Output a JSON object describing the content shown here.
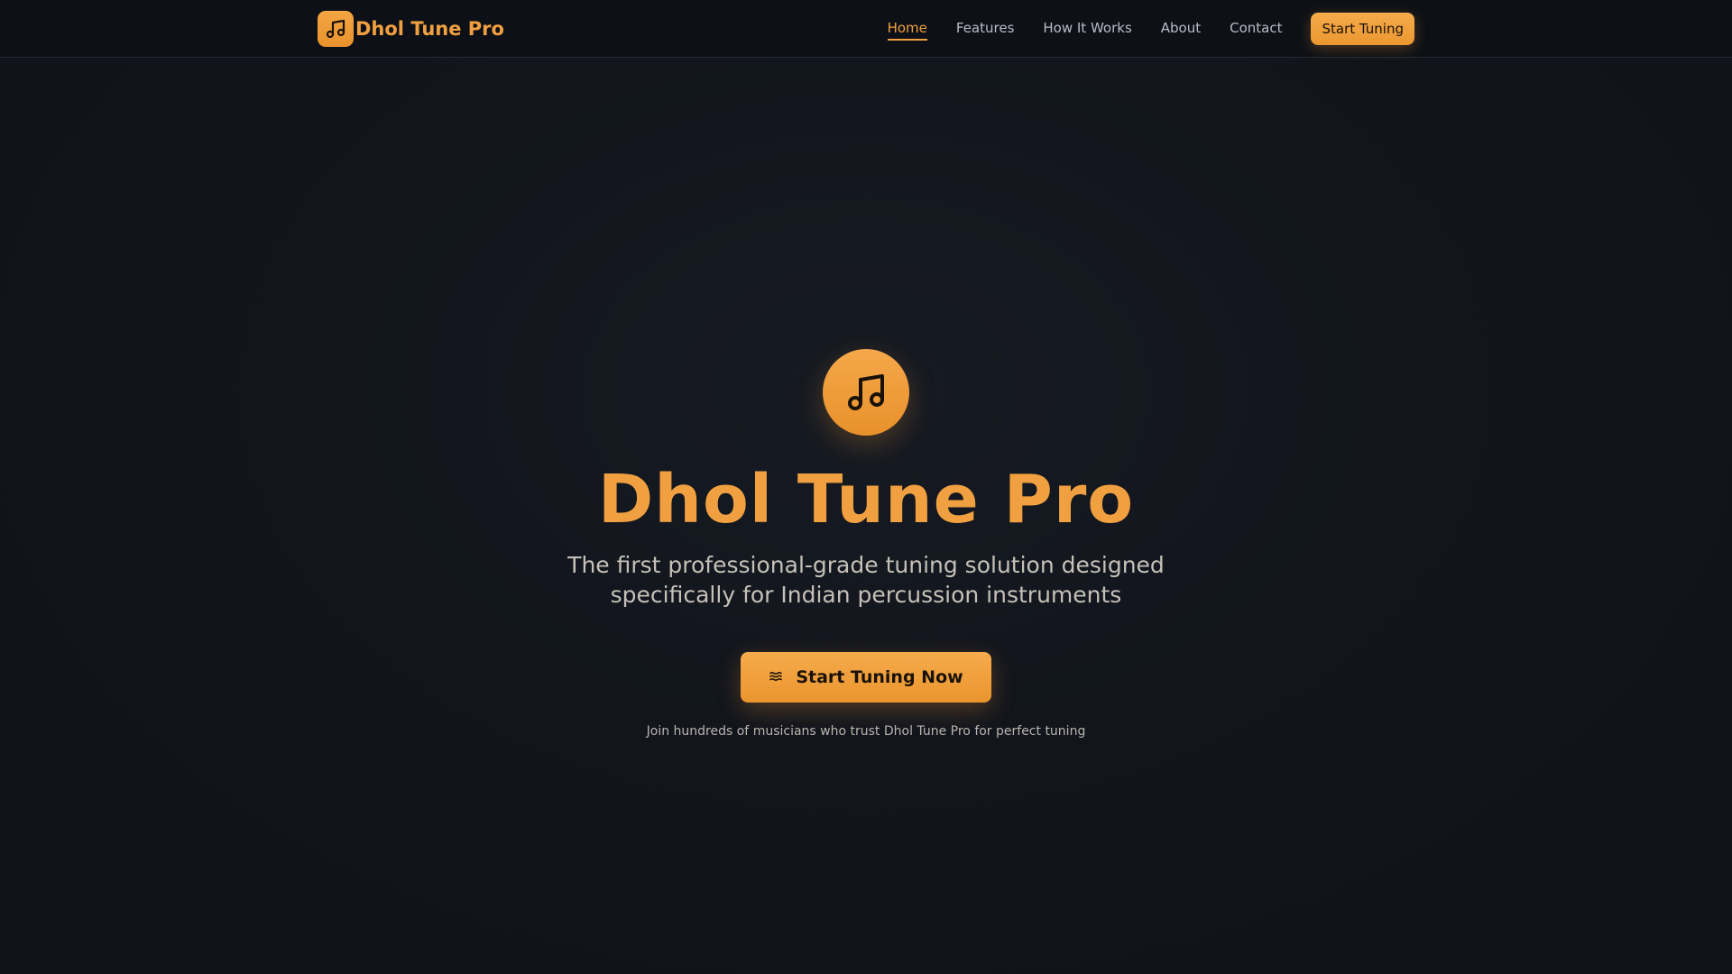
{
  "nav": {
    "brand_name": "Dhol Tune Pro",
    "brand_icon": "music-note-icon",
    "links": [
      {
        "label": "Home",
        "active": true
      },
      {
        "label": "Features",
        "active": false
      },
      {
        "label": "How It Works",
        "active": false
      },
      {
        "label": "About",
        "active": false
      },
      {
        "label": "Contact",
        "active": false
      }
    ],
    "cta_label": "Start Tuning"
  },
  "hero": {
    "icon": "music-note-icon",
    "title": "Dhol Tune Pro",
    "subtitle": "The first professional-grade tuning solution designed specifically for Indian percussion instruments",
    "cta_label": "Start Tuning Now",
    "cta_icon": "waves-icon",
    "note": "Join hundreds of musicians who trust Dhol Tune Pro for perfect tuning"
  },
  "colors": {
    "accent": "#f0a040",
    "background": "#12151c",
    "navbar": "#0d1016"
  }
}
